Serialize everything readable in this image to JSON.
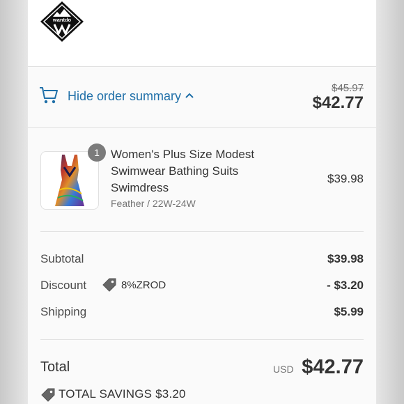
{
  "brand": {
    "logo_text": "wantdo"
  },
  "summary_bar": {
    "toggle_label": "Hide order summary",
    "old_price": "$45.97",
    "total": "$42.77"
  },
  "items": [
    {
      "quantity": "1",
      "name": "Women's Plus Size Modest Swimwear Bathing Suits Swimdress",
      "variant": "Feather / 22W-24W",
      "price": "$39.98"
    }
  ],
  "totals": {
    "subtotal_label": "Subtotal",
    "subtotal_value": "$39.98",
    "discount_label": "Discount",
    "discount_code": "8%ZROD",
    "discount_value": "- $3.20",
    "shipping_label": "Shipping",
    "shipping_value": "$5.99",
    "total_label": "Total",
    "currency": "USD",
    "total_value": "$42.77",
    "savings": "TOTAL SAVINGS $3.20"
  },
  "colors": {
    "accent": "#1f6fa8",
    "text": "#333333",
    "muted": "#737373"
  },
  "icons": [
    "cart-icon",
    "chevron-up-icon",
    "tag-icon"
  ]
}
